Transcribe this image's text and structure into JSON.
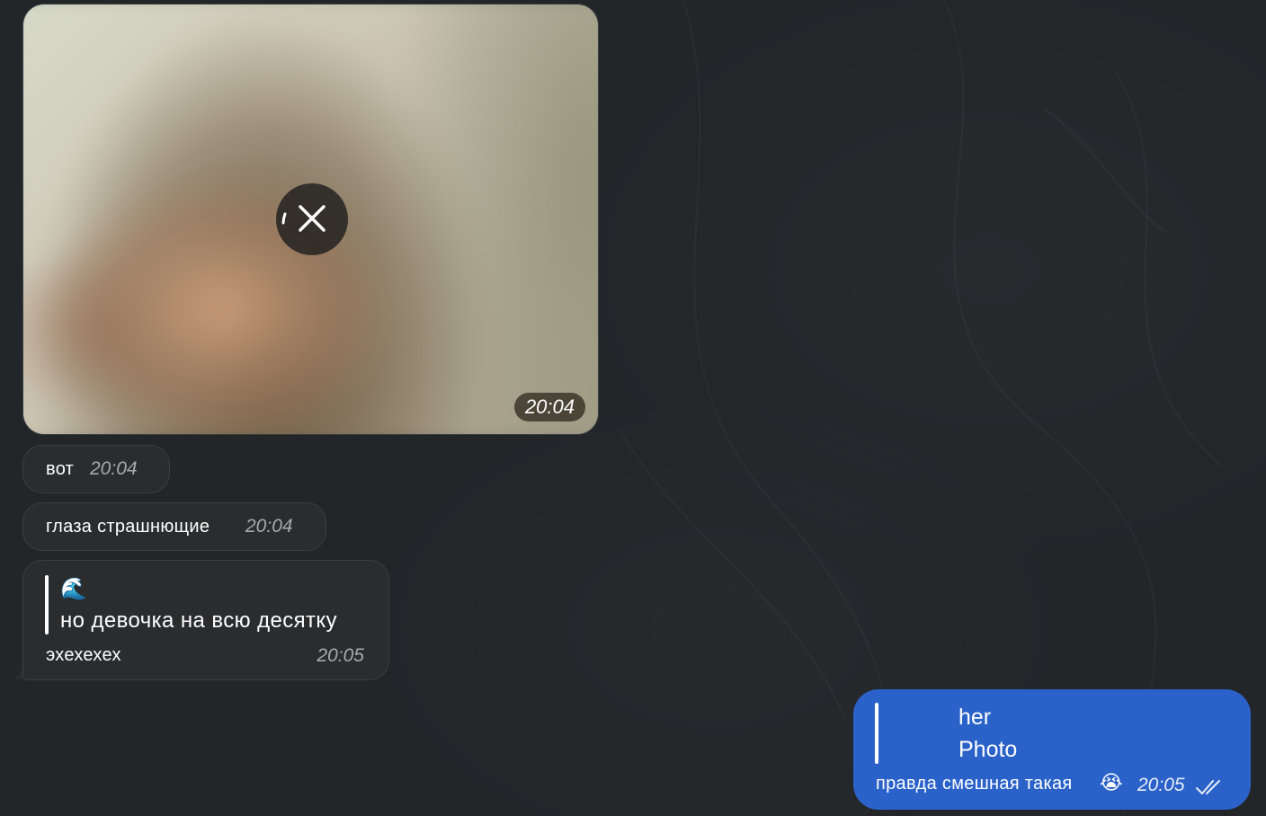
{
  "messages": {
    "photo": {
      "time": "20:04",
      "icon": "cancel-download-icon"
    },
    "msg1": {
      "text": "вот",
      "time": "20:04"
    },
    "msg2": {
      "text": "глаза страшнющие",
      "time": "20:04"
    },
    "msg3": {
      "quote_emoji": "🌊",
      "quote_text": "но девочка на всю десятку",
      "text": "эхехехех",
      "time": "20:05"
    },
    "outgoing": {
      "reply_title": "her",
      "reply_subtitle": "Photo",
      "text": "правда смешная такая",
      "emoji": "😭",
      "time": "20:05",
      "status_icon": "double-check-icon"
    }
  },
  "colors": {
    "background": "#22262a",
    "incoming_bubble": "#2b2c2e",
    "outgoing_bubble": "#2a62c9"
  }
}
